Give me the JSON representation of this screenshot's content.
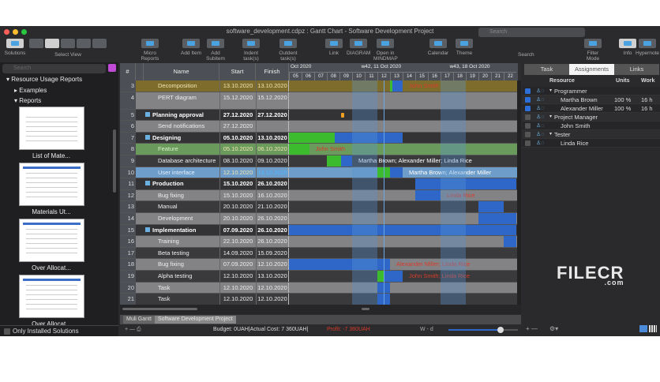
{
  "window": {
    "title": "software_development.cdpz : Gantt Chart - Software Development Project"
  },
  "toolbar": [
    {
      "label": "Solutions",
      "icon": "solutions-icon"
    },
    {
      "label": "Select View",
      "icon": "view-icon"
    },
    {
      "label": "Micro Reports",
      "icon": "micro-reports-icon"
    },
    {
      "label": "Add Item",
      "icon": "add-item-icon"
    },
    {
      "label": "Add Subitem",
      "icon": "add-subitem-icon"
    },
    {
      "label": "Indent task(s)",
      "icon": "indent-icon"
    },
    {
      "label": "Outdent task(s)",
      "icon": "outdent-icon"
    },
    {
      "label": "Link",
      "icon": "link-icon"
    },
    {
      "label": "DIAGRAM",
      "icon": "diagram-icon"
    },
    {
      "label": "Open in MINDMAP",
      "icon": "mindmap-icon"
    },
    {
      "label": "Calendar",
      "icon": "calendar-icon"
    },
    {
      "label": "Theme",
      "icon": "theme-icon"
    },
    {
      "label": "Search",
      "icon": "search-icon"
    },
    {
      "label": "Filter Mode",
      "icon": "filter-icon"
    },
    {
      "label": "Info",
      "icon": "info-icon"
    },
    {
      "label": "Hypernote",
      "icon": "hypernote-icon"
    }
  ],
  "search": {
    "placeholder": "Search"
  },
  "sidebar": {
    "search_placeholder": "Search",
    "root": "Resource Usage Reports",
    "examples": "Examples",
    "reports": "Reports",
    "items": [
      "List of Mate...",
      "Materials Ut...",
      "Over Allocat...",
      "Over Allocat..."
    ],
    "only_installed": "Only Installed Solutions"
  },
  "gantt": {
    "headers": {
      "num": "#",
      "name": "Name",
      "start": "Start",
      "finish": "Finish"
    },
    "months": [
      {
        "label": "Oct 2020"
      },
      {
        "label": "w42, 11 Oct 2020"
      },
      {
        "label": "w43, 18 Oct 2020"
      }
    ],
    "days": [
      "05",
      "06",
      "07",
      "08",
      "09",
      "10",
      "11",
      "12",
      "13",
      "14",
      "15",
      "16",
      "17",
      "18",
      "19",
      "20",
      "21",
      "22"
    ],
    "rows": [
      {
        "num": "3",
        "name": "Decomposition",
        "start": "13.10.2020",
        "finish": "13.10.2020",
        "bar": [
          8,
          9
        ],
        "progress": 0.2,
        "res": "John Smith",
        "hl": "#7d6c2c"
      },
      {
        "num": "4",
        "name": "PERT diagram",
        "start": "15.12.2020",
        "finish": "15.12.2020"
      },
      {
        "num": "5",
        "name": "Planning approval",
        "start": "27.12.2020",
        "finish": "27.12.2020",
        "summary": true
      },
      {
        "num": "6",
        "name": "Send notifications",
        "start": "27.12.2020",
        "finish": ""
      },
      {
        "num": "7",
        "name": "Designing",
        "start": "05.10.2020",
        "finish": "13.10.2020",
        "summary": true,
        "bar": [
          0,
          9
        ],
        "progress": 0.4
      },
      {
        "num": "8",
        "name": "Feature",
        "start": "05.10.2020",
        "finish": "06.10.2020",
        "bar": [
          0,
          1.6
        ],
        "progress": 1,
        "res": "John Smith",
        "hl": "#6a9a5c"
      },
      {
        "num": "9",
        "name": "Database architecture",
        "start": "08.10.2020",
        "finish": "09.10.2020",
        "bar": [
          3,
          5
        ],
        "progress": 0.55,
        "res": "Martha Brown; Alexander Miller; Linda Rice"
      },
      {
        "num": "10",
        "name": "User interface",
        "start": "12.10.2020",
        "finish": "13.10.2020",
        "bar": [
          7,
          9
        ],
        "progress": 0.5,
        "res": "Martha Brown; Alexander Miller",
        "hl": "#6f9dc9"
      },
      {
        "num": "11",
        "name": "Production",
        "start": "15.10.2020",
        "finish": "26.10.2020",
        "summary": true,
        "bar": [
          10,
          18
        ]
      },
      {
        "num": "12",
        "name": "Bug fixing",
        "start": "15.10.2020",
        "finish": "16.10.2020",
        "bar": [
          10,
          12
        ],
        "res": "Linda Rice"
      },
      {
        "num": "13",
        "name": "Manual",
        "start": "20.10.2020",
        "finish": "21.10.2020",
        "bar": [
          15,
          17
        ]
      },
      {
        "num": "14",
        "name": "Development",
        "start": "20.10.2020",
        "finish": "26.10.2020",
        "bar": [
          15,
          18
        ]
      },
      {
        "num": "15",
        "name": "Implementation",
        "start": "07.09.2020",
        "finish": "26.10.2020",
        "summary": true,
        "bar": [
          0,
          18
        ]
      },
      {
        "num": "16",
        "name": "Training",
        "start": "22.10.2020",
        "finish": "26.10.2020",
        "bar": [
          17,
          18
        ]
      },
      {
        "num": "17",
        "name": "Beta testing",
        "start": "14.09.2020",
        "finish": "15.09.2020"
      },
      {
        "num": "18",
        "name": "Bug fixing",
        "start": "07.09.2020",
        "finish": "12.10.2020",
        "bar": [
          0,
          8
        ],
        "res": "Alexander Miller; Linda Rice"
      },
      {
        "num": "19",
        "name": "Alpha testing",
        "start": "12.10.2020",
        "finish": "13.10.2020",
        "bar": [
          7,
          9
        ],
        "progress": 0.25,
        "res": "John Smith; Linda Rice"
      },
      {
        "num": "20",
        "name": "Task",
        "start": "12.10.2020",
        "finish": "12.10.2020",
        "bar": [
          7,
          8
        ]
      },
      {
        "num": "21",
        "name": "Task",
        "start": "12.10.2020",
        "finish": "12.10.2020",
        "bar": [
          7,
          8
        ]
      }
    ]
  },
  "tabs": [
    "Muli Gantt",
    "Software Development Project"
  ],
  "status": {
    "budget": "Budget: 0UAH|Actual Cost: 7 360UAH|",
    "profit": "Profit: -7 360UAH",
    "scale": "W - d",
    "zoom": 0.75
  },
  "right": {
    "tabs": [
      "Task",
      "Assignments",
      "Links"
    ],
    "active": "Assignments",
    "headers": {
      "resource": "Resource",
      "units": "Units",
      "work": "Work"
    },
    "rows": [
      {
        "name": "Programmer",
        "group": true,
        "checked": true,
        "units": "",
        "work": ""
      },
      {
        "name": "Martha Brown",
        "checked": true,
        "units": "100 %",
        "work": "16 h"
      },
      {
        "name": "Alexander Miller",
        "checked": true,
        "units": "100 %",
        "work": "16 h"
      },
      {
        "name": "Project Manager",
        "group": true,
        "checked": false,
        "units": "",
        "work": ""
      },
      {
        "name": "John Smith",
        "checked": false,
        "units": "",
        "work": ""
      },
      {
        "name": "Tester",
        "group": true,
        "checked": false,
        "units": "",
        "work": ""
      },
      {
        "name": "Linda Rice",
        "checked": false,
        "units": "",
        "work": ""
      }
    ]
  },
  "colors": {
    "bar": "#2f67c9",
    "progress": "#3dbb2f",
    "resource": "#d83a2a"
  }
}
